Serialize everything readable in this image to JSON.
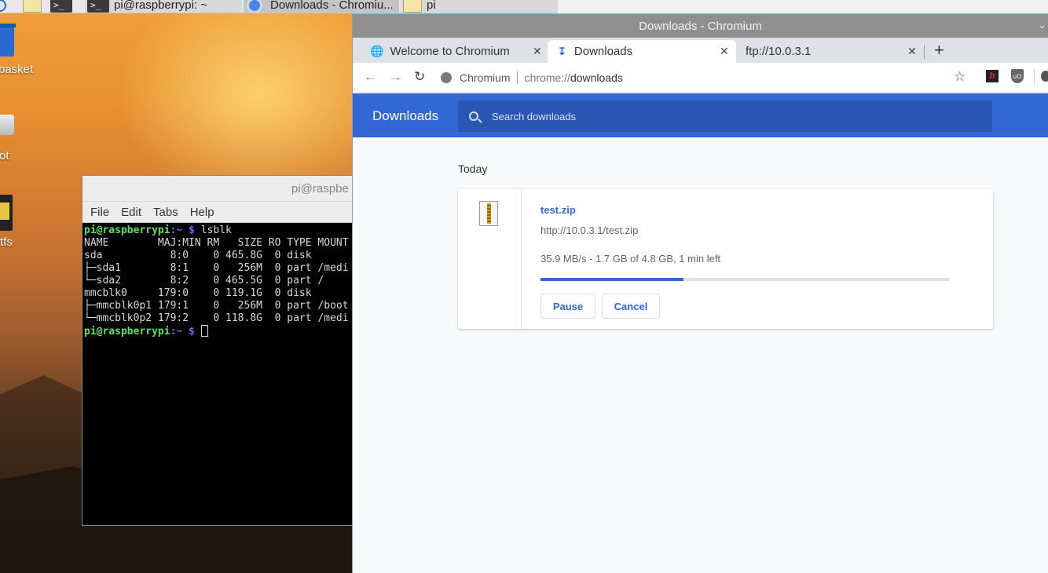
{
  "taskbar": {
    "tasks": [
      {
        "label": "pi@raspberrypi: ~"
      },
      {
        "label": "Downloads - Chromiu..."
      },
      {
        "label": "pi"
      }
    ]
  },
  "desktop": {
    "icons": [
      {
        "label": "basket",
        "icon": "wastebasket-icon"
      },
      {
        "label": "ot",
        "icon": "drive-icon"
      },
      {
        "label": "tfs",
        "icon": "sd-card-icon"
      }
    ]
  },
  "terminal": {
    "title": "pi@raspbe",
    "menu": [
      "File",
      "Edit",
      "Tabs",
      "Help"
    ],
    "prompt_user": "pi@raspberrypi",
    "prompt_path": ":~",
    "prompt_symbol": " $",
    "command": " lsblk",
    "output": [
      "NAME        MAJ:MIN RM   SIZE RO TYPE MOUNT",
      "sda           8:0    0 465.8G  0 disk",
      "├─sda1        8:1    0   256M  0 part /medi",
      "└─sda2        8:2    0 465.5G  0 part /",
      "mmcblk0     179:0    0 119.1G  0 disk",
      "├─mmcblk0p1 179:1    0   256M  0 part /boot",
      "└─mmcblk0p2 179:2    0 118.8G  0 part /medi"
    ]
  },
  "chromium": {
    "window_title": "Downloads - Chromium",
    "tabs": [
      {
        "label": "Welcome to Chromium",
        "icon": "globe-icon"
      },
      {
        "label": "Downloads",
        "icon": "download-icon",
        "active": true
      },
      {
        "label": "ftp://10.0.3.1",
        "icon": "none"
      }
    ],
    "new_tab": "+",
    "omnibox": {
      "site": "Chromium",
      "scheme": "chrome://",
      "host": "downloads"
    },
    "extensions": [
      "h",
      "uO"
    ],
    "downloads": {
      "header_title": "Downloads",
      "search_placeholder": "Search downloads",
      "date_group": "Today",
      "item": {
        "filename": "test.zip",
        "url": "http://10.0.3.1/test.zip",
        "status": "35.9 MB/s - 1.7 GB of 4.8 GB, 1 min left",
        "progress": 0.35,
        "pause_label": "Pause",
        "cancel_label": "Cancel"
      }
    }
  },
  "colors": {
    "accent": "#3367d6",
    "header_bg": "#3367d6",
    "search_bg": "#2a56b4"
  }
}
